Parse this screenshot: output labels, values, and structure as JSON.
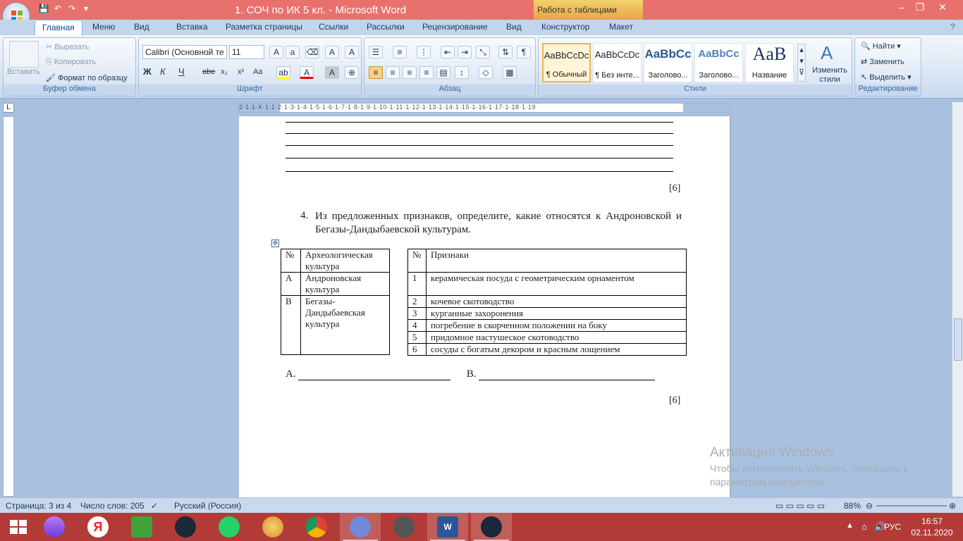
{
  "window": {
    "title": "1. СОЧ по ИК 5 кл. - Microsoft Word",
    "context_tab": "Работа с таблицами",
    "controls": {
      "minimize": "–",
      "restore": "❐",
      "close": "✕"
    }
  },
  "qat": {
    "icons": [
      "save-icon",
      "undo-icon",
      "redo-icon",
      "customize-icon"
    ]
  },
  "tabs": [
    "Главная",
    "Меню",
    "Вид",
    "Вставка",
    "Разметка страницы",
    "Ссылки",
    "Рассылки",
    "Рецензирование",
    "Вид",
    "Конструктор",
    "Макет"
  ],
  "ribbon": {
    "clipboard": {
      "paste": "Вставить",
      "cut": "Вырезать",
      "copy": "Копировать",
      "format_painter": "Формат по образцу",
      "label": "Буфер обмена"
    },
    "font": {
      "name": "Calibri (Основной те",
      "size": "11",
      "bold": "Ж",
      "italic": "К",
      "underline": "Ч",
      "strike": "abe",
      "subscript": "x₂",
      "superscript": "x²",
      "case": "Aa",
      "label": "Шрифт"
    },
    "paragraph": {
      "label": "Абзац"
    },
    "styles": {
      "items": [
        {
          "sample": "AaBbCcDc",
          "name": "¶ Обычный"
        },
        {
          "sample": "AaBbCcDc",
          "name": "¶ Без инте..."
        },
        {
          "sample": "AaBbCc",
          "name": "Заголово..."
        },
        {
          "sample": "AaBbCc",
          "name": "Заголово..."
        },
        {
          "sample": "AaB",
          "name": "Название"
        }
      ],
      "change": "Изменить стили",
      "label": "Стили"
    },
    "editing": {
      "find": "Найти",
      "replace": "Заменить",
      "select": "Выделить",
      "label": "Редактирование"
    }
  },
  "ruler": {
    "h_numbers": "2·1·1·X·1·1·2·1·3·1·4·1·5·1·6·1·7·1·8·1·9·1·10·1·11·1·12·1·13·1·14·1·15·1·16·1·17·1·18·1·19"
  },
  "document": {
    "mark1": "[6]",
    "question_number": "4.",
    "question": "Из предложенных признаков, определите, какие относятся к Андроновской и Бегазы-Дандыбаевской культурам.",
    "table_left": {
      "header": [
        "№",
        "Археологическая культура"
      ],
      "rows": [
        [
          "А",
          "Андроновская культура"
        ],
        [
          "В",
          "Бегазы-Дандыбаевская культура"
        ]
      ]
    },
    "table_right": {
      "header": [
        "№",
        "Признаки"
      ],
      "rows": [
        [
          "1",
          "керамическая посуда с геометрическим орнаментом"
        ],
        [
          "2",
          "кочевое скотоводство"
        ],
        [
          "3",
          "курганные захоронения"
        ],
        [
          "4",
          "погребение в скорченном положении на боку"
        ],
        [
          "5",
          "придомное пастушеское скотоводство"
        ],
        [
          "6",
          "сосуды с богатым декором и красным лощением"
        ]
      ]
    },
    "answer_a": "А.",
    "answer_b": "В.",
    "mark2": "[6]"
  },
  "activation": {
    "title": "Активация Windows",
    "line1": "Чтобы активировать Windows, перейдите к",
    "line2": "параметрам компьютера."
  },
  "status": {
    "page": "Страница: 3 из 4",
    "words": "Число слов: 205",
    "language": "Русский (Россия)",
    "zoom": "88%"
  },
  "taskbar": {
    "lang": "РУС",
    "time": "16:57",
    "date": "02.11.2020"
  }
}
